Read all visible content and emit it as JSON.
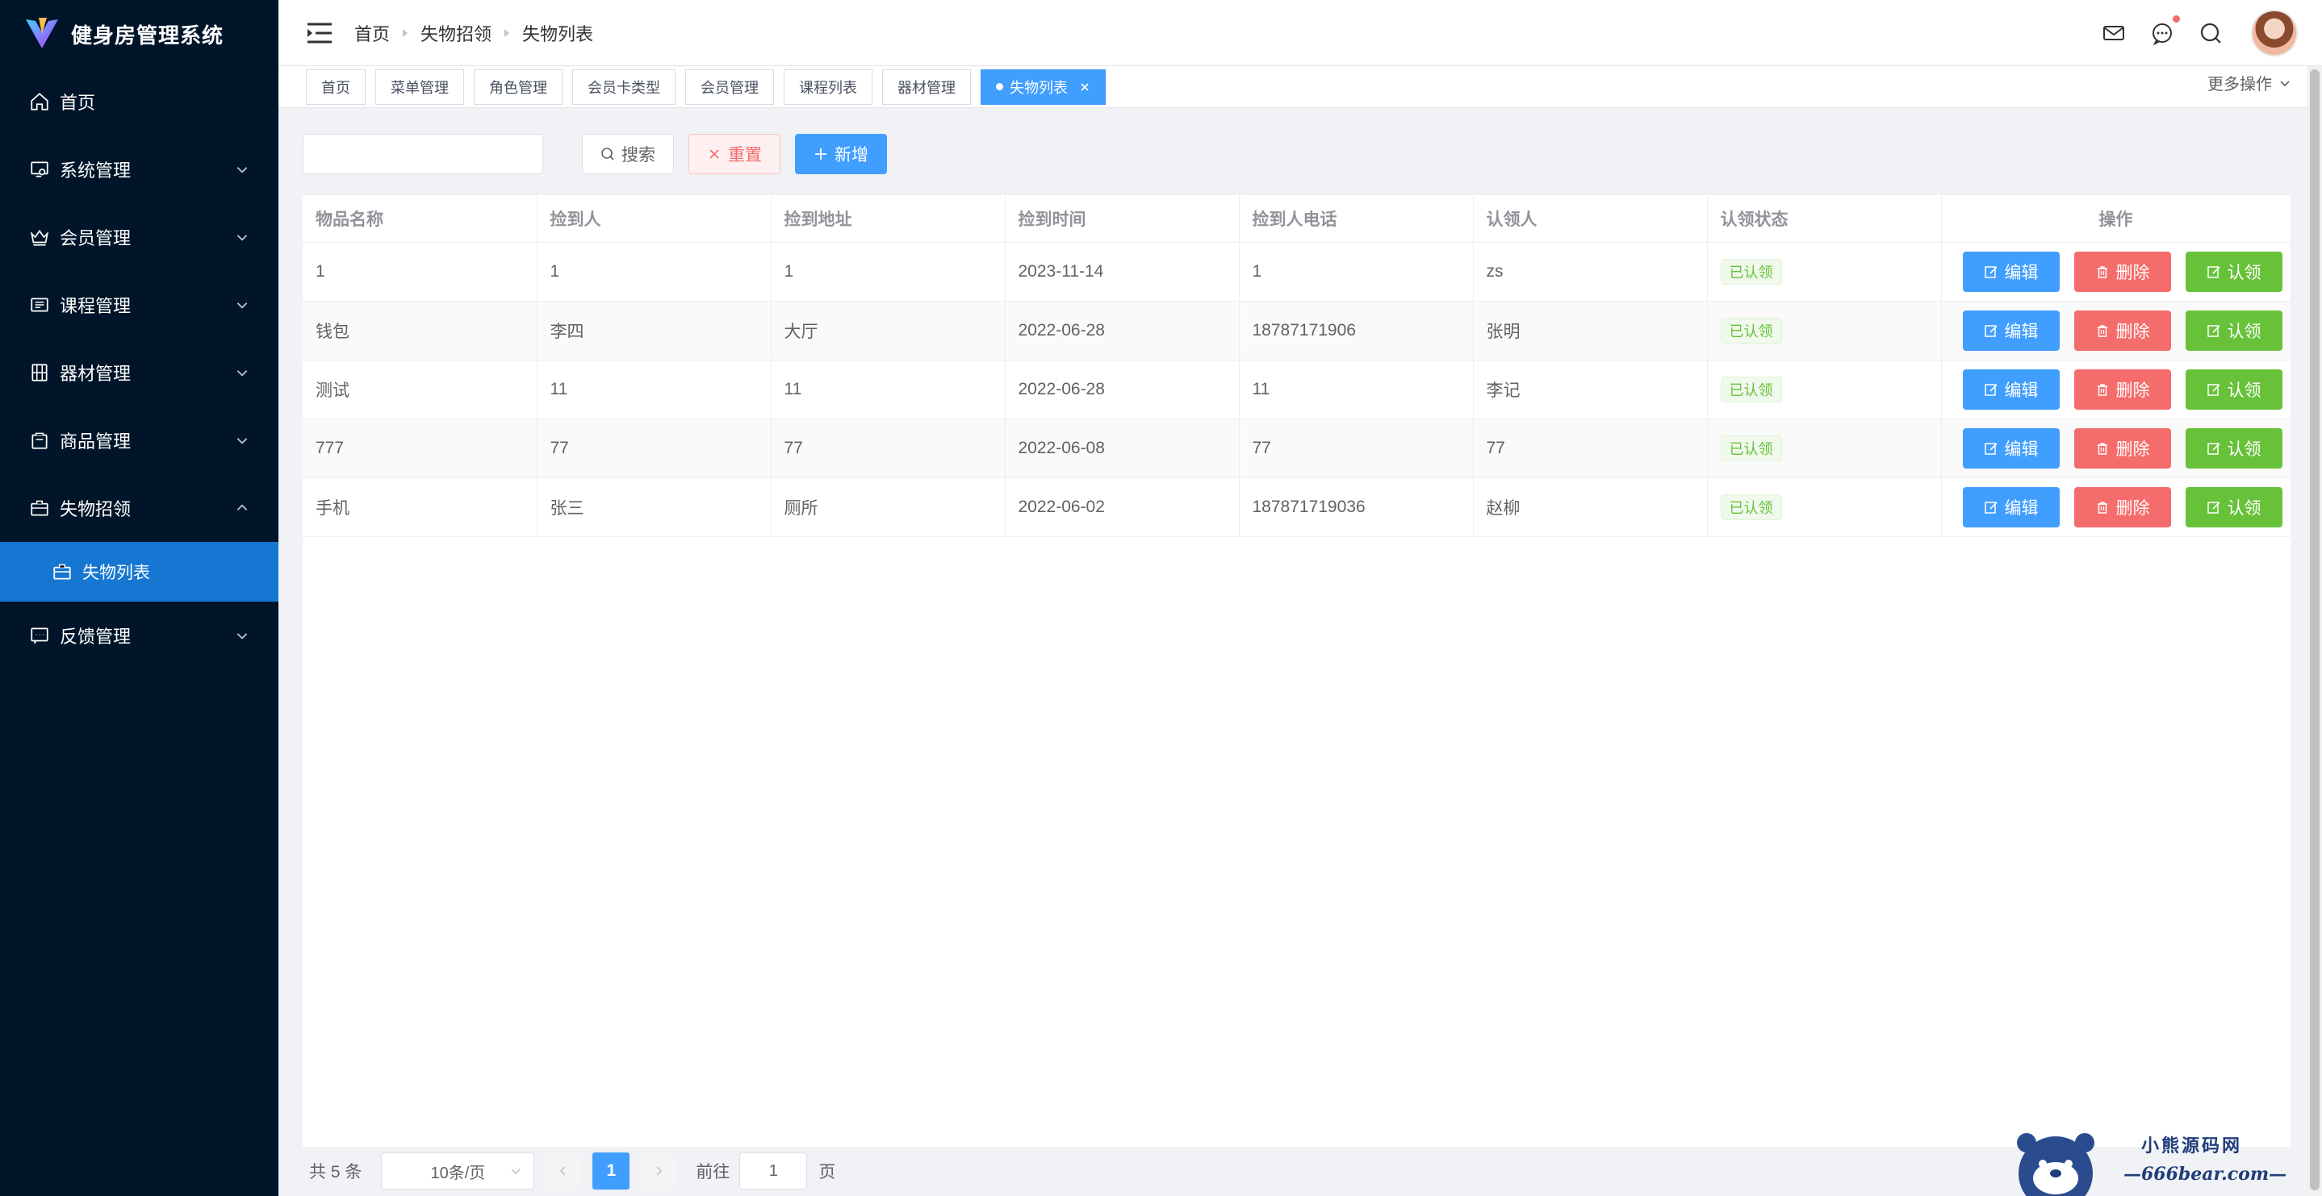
{
  "app": {
    "title": "健身房管理系统"
  },
  "sidebar": {
    "items": [
      {
        "label": "首页",
        "icon": "home-icon"
      },
      {
        "label": "系统管理",
        "icon": "system-icon"
      },
      {
        "label": "会员管理",
        "icon": "crown-icon"
      },
      {
        "label": "课程管理",
        "icon": "course-icon"
      },
      {
        "label": "器材管理",
        "icon": "equipment-icon"
      },
      {
        "label": "商品管理",
        "icon": "goods-icon"
      },
      {
        "label": "失物招领",
        "icon": "briefcase-icon"
      },
      {
        "label": "反馈管理",
        "icon": "feedback-icon"
      }
    ],
    "active_sub": {
      "label": "失物列表",
      "icon": "briefcase-icon"
    }
  },
  "breadcrumb": [
    "首页",
    "失物招领",
    "失物列表"
  ],
  "tags": [
    "首页",
    "菜单管理",
    "角色管理",
    "会员卡类型",
    "会员管理",
    "课程列表",
    "器材管理",
    "失物列表"
  ],
  "more_ops": "更多操作",
  "toolbar": {
    "search_value": "",
    "search_label": "搜索",
    "reset_label": "重置",
    "add_label": "新增"
  },
  "table": {
    "headers": [
      "物品名称",
      "捡到人",
      "捡到地址",
      "捡到时间",
      "捡到人电话",
      "认领人",
      "认领状态",
      "操作"
    ],
    "rows": [
      {
        "name": "1",
        "finder": "1",
        "address": "1",
        "time": "2023-11-14",
        "phone": "1",
        "claimer": "zs",
        "status": "已认领"
      },
      {
        "name": "钱包",
        "finder": "李四",
        "address": "大厅",
        "time": "2022-06-28",
        "phone": "18787171906",
        "claimer": "张明",
        "status": "已认领"
      },
      {
        "name": "测试",
        "finder": "11",
        "address": "11",
        "time": "2022-06-28",
        "phone": "11",
        "claimer": "李记",
        "status": "已认领"
      },
      {
        "name": "777",
        "finder": "77",
        "address": "77",
        "time": "2022-06-08",
        "phone": "77",
        "claimer": "77",
        "status": "已认领"
      },
      {
        "name": "手机",
        "finder": "张三",
        "address": "厕所",
        "time": "2022-06-02",
        "phone": "187871719036",
        "claimer": "赵柳",
        "status": "已认领"
      }
    ],
    "actions": {
      "edit": "编辑",
      "delete": "删除",
      "claim": "认领"
    }
  },
  "pagination": {
    "total": "共 5 条",
    "page_size": "10条/页",
    "current": "1",
    "goto_label": "前往",
    "goto_value": "1",
    "page_label": "页"
  },
  "watermark": {
    "title": "小熊源码网",
    "url": "—666bear.com—"
  },
  "colors": {
    "sidebar": "#001529",
    "active": "#1677d2",
    "primary": "#409eff",
    "danger": "#f56c6c",
    "success": "#67c23a"
  }
}
